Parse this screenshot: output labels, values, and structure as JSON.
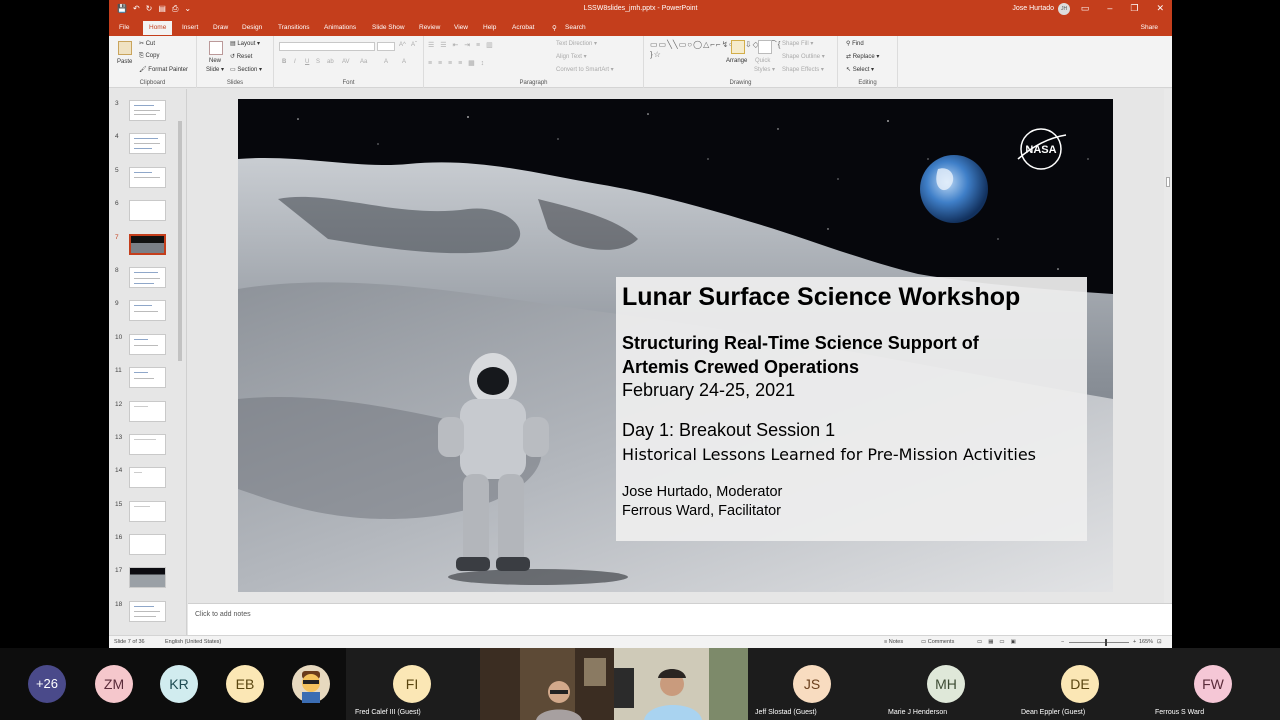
{
  "window": {
    "title": "LSSW8slides_jmh.pptx  -  PowerPoint",
    "user": "Jose Hurtado",
    "user_initials": "JH",
    "qat": [
      "💾",
      "↶",
      "↻",
      "▤",
      "⎙",
      "⌄"
    ],
    "min": "–",
    "max": "❐",
    "close": "✕",
    "restore": "▭"
  },
  "tabs": [
    "File",
    "Home",
    "Insert",
    "Draw",
    "Design",
    "Transitions",
    "Animations",
    "Slide Show",
    "Review",
    "View",
    "Help",
    "Acrobat"
  ],
  "active_tab": "Home",
  "search_label": "Search",
  "share_label": "Share",
  "ribbon": {
    "clipboard": {
      "paste": "Paste",
      "cut": "Cut",
      "copy": "Copy",
      "format_painter": "Format Painter",
      "label": "Clipboard"
    },
    "slides": {
      "new_slide": "New",
      "new_slide2": "Slide ▾",
      "layout": "Layout ▾",
      "reset": "Reset",
      "section": "Section ▾",
      "label": "Slides"
    },
    "font": {
      "bold": "B",
      "italic": "I",
      "underline": "U",
      "strike": "S",
      "shadow": "ab",
      "spacing": "AV",
      "case": "Aa",
      "color": "A",
      "grow": "A^",
      "shrink": "Aˇ",
      "clear": "A",
      "label": "Font"
    },
    "paragraph": {
      "text_direction": "Text Direction ▾",
      "align_text": "Align Text ▾",
      "smartart": "Convert to SmartArt ▾",
      "label": "Paragraph"
    },
    "drawing": {
      "arrange": "Arrange",
      "quick_styles": "Quick",
      "quick_styles2": "Styles ▾",
      "shape_fill": "Shape Fill ▾",
      "shape_outline": "Shape Outline ▾",
      "shape_effects": "Shape Effects ▾",
      "label": "Drawing",
      "shapes": "▭▭╲╲▭○◯△⌐⌐↯⇨⬠⇩◇⌒⌒{ }☆"
    },
    "editing": {
      "find": "Find",
      "replace": "Replace ▾",
      "select": "Select ▾",
      "label": "Editing"
    }
  },
  "thumbnails": [
    "3",
    "4",
    "5",
    "6",
    "7",
    "8",
    "9",
    "10",
    "11",
    "12",
    "13",
    "14",
    "15",
    "16",
    "17",
    "18"
  ],
  "active_slide_number": "7",
  "slide": {
    "title": "Lunar Surface Science Workshop",
    "subtitle_line1": "Structuring Real-Time Science Support of",
    "subtitle_line2": "Artemis Crewed Operations",
    "dates": "February 24-25, 2021",
    "session": "Day 1: Breakout Session 1",
    "session_topic": "Historical Lessons Learned for Pre-Mission Activities",
    "person1": "Jose Hurtado, Moderator",
    "person2": "Ferrous Ward, Facilitator",
    "logo_text": "NASA"
  },
  "notes_placeholder": "Click to add notes",
  "status": {
    "slide_of": "Slide 7 of 36",
    "language": "English (United States)",
    "notes": "Notes",
    "comments": "Comments",
    "zoom": "165%",
    "zoom_minus": "−",
    "zoom_plus": "+"
  },
  "participants": [
    {
      "initials": "+26",
      "name": "",
      "color": "#4a4a8a"
    },
    {
      "initials": "ZM",
      "name": "",
      "color": "#f5c7cc"
    },
    {
      "initials": "KR",
      "name": "",
      "color": "#d1ecef"
    },
    {
      "initials": "EB",
      "name": "",
      "color": "#fbe7b5"
    },
    {
      "initials": "FI",
      "name": "Fred Calef III (Guest)",
      "color": "#fbe7b5"
    },
    {
      "initials": "JS",
      "name": "Jeff Slostad (Guest)",
      "color": "#f8dcc0"
    },
    {
      "initials": "MH",
      "name": "Marie J Henderson",
      "color": "#dfe8d9"
    },
    {
      "initials": "DE",
      "name": "Dean Eppler (Guest)",
      "color": "#fbe7b5"
    },
    {
      "initials": "FW",
      "name": "Ferrous S Ward",
      "color": "#f5c7d6"
    }
  ]
}
